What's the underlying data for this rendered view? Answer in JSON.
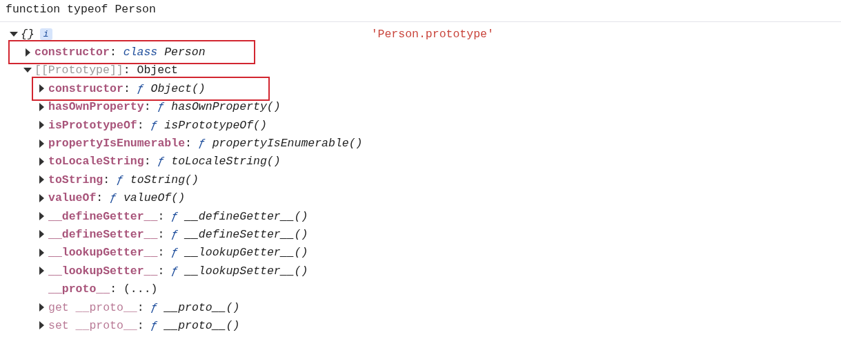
{
  "log_line": "function typeof Person",
  "annotation": "'Person.prototype'",
  "tree": {
    "value": "{}",
    "badge": "i",
    "expanded": true,
    "children": [
      {
        "key": "constructor",
        "colon": ":",
        "kind": "own",
        "expanded": false,
        "highlighted": true,
        "value_prefix": "class",
        "value": "Person"
      },
      {
        "key": "[[Prototype]]",
        "colon": ":",
        "kind": "internal",
        "expanded": true,
        "highlighted": false,
        "value": "Object",
        "children": [
          {
            "key": "constructor",
            "colon": ":",
            "kind": "own",
            "expanded": false,
            "highlighted": true,
            "value_prefix": "ƒ",
            "value": "Object()"
          },
          {
            "key": "hasOwnProperty",
            "colon": ":",
            "kind": "own",
            "expanded": false,
            "highlighted": false,
            "value_prefix": "ƒ",
            "value": "hasOwnProperty()"
          },
          {
            "key": "isPrototypeOf",
            "colon": ":",
            "kind": "own",
            "expanded": false,
            "highlighted": false,
            "value_prefix": "ƒ",
            "value": "isPrototypeOf()"
          },
          {
            "key": "propertyIsEnumerable",
            "colon": ":",
            "kind": "own",
            "expanded": false,
            "highlighted": false,
            "value_prefix": "ƒ",
            "value": "propertyIsEnumerable()"
          },
          {
            "key": "toLocaleString",
            "colon": ":",
            "kind": "own",
            "expanded": false,
            "highlighted": false,
            "value_prefix": "ƒ",
            "value": "toLocaleString()"
          },
          {
            "key": "toString",
            "colon": ":",
            "kind": "own",
            "expanded": false,
            "highlighted": false,
            "value_prefix": "ƒ",
            "value": "toString()"
          },
          {
            "key": "valueOf",
            "colon": ":",
            "kind": "own",
            "expanded": false,
            "highlighted": false,
            "value_prefix": "ƒ",
            "value": "valueOf()"
          },
          {
            "key": "__defineGetter__",
            "colon": ":",
            "kind": "own",
            "expanded": false,
            "highlighted": false,
            "value_prefix": "ƒ",
            "value": "__defineGetter__()"
          },
          {
            "key": "__defineSetter__",
            "colon": ":",
            "kind": "own",
            "expanded": false,
            "highlighted": false,
            "value_prefix": "ƒ",
            "value": "__defineSetter__()"
          },
          {
            "key": "__lookupGetter__",
            "colon": ":",
            "kind": "own",
            "expanded": false,
            "highlighted": false,
            "value_prefix": "ƒ",
            "value": "__lookupGetter__()"
          },
          {
            "key": "__lookupSetter__",
            "colon": ":",
            "kind": "own",
            "expanded": false,
            "highlighted": false,
            "value_prefix": "ƒ",
            "value": "__lookupSetter__()"
          },
          {
            "key": "__proto__",
            "colon": ":",
            "kind": "own",
            "highlighted": false,
            "value": "(...)"
          },
          {
            "key": "get __proto__",
            "colon": ":",
            "kind": "accessor",
            "expanded": false,
            "highlighted": false,
            "value_prefix": "ƒ",
            "value": "__proto__()"
          },
          {
            "key": "set __proto__",
            "colon": ":",
            "kind": "accessor",
            "expanded": false,
            "highlighted": false,
            "value_prefix": "ƒ",
            "value": "__proto__()"
          }
        ]
      }
    ]
  }
}
